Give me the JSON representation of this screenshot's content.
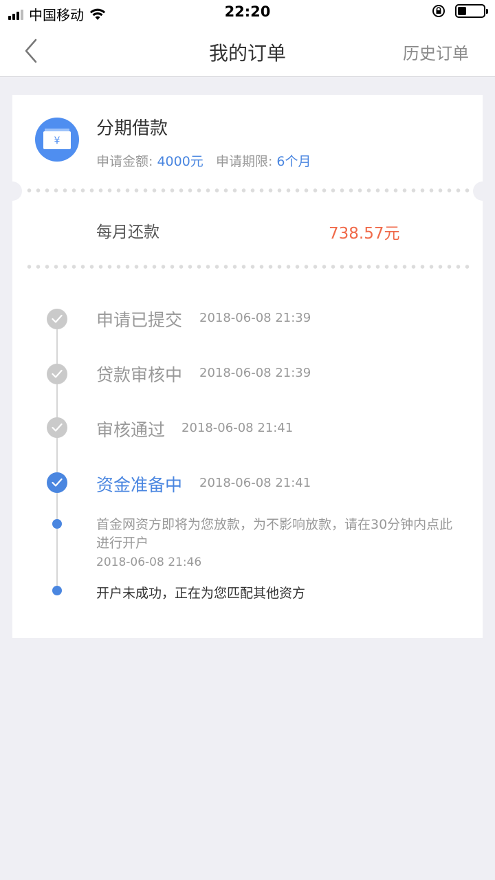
{
  "status_bar": {
    "carrier": "中国移动",
    "time": "22:20"
  },
  "nav": {
    "title": "我的订单",
    "history_link": "历史订单"
  },
  "order": {
    "product_name": "分期借款",
    "amount_label": "申请金额: ",
    "amount_value": "4000元",
    "term_label": "申请期限: ",
    "term_value": "6个月",
    "monthly_label": "每月还款",
    "monthly_value": "738.57元",
    "icon": "wallet-yen-icon"
  },
  "timeline": {
    "steps": [
      {
        "title": "申请已提交",
        "time": "2018-06-08 21:39",
        "active": false
      },
      {
        "title": "贷款审核中",
        "time": "2018-06-08 21:39",
        "active": false
      },
      {
        "title": "审核通过",
        "time": "2018-06-08 21:41",
        "active": false
      },
      {
        "title": "资金准备中",
        "time": "2018-06-08 21:41",
        "active": true
      }
    ],
    "sub_events": [
      {
        "text": "首金网资方即将为您放款，为不影响放款，请在30分钟内点此进行开户",
        "time": "2018-06-08 21:46"
      },
      {
        "text": "开户未成功，正在为您匹配其他资方",
        "time": ""
      }
    ]
  },
  "colors": {
    "accent": "#4a86e0",
    "amount_red": "#f06a4a",
    "background": "#efeff4"
  }
}
